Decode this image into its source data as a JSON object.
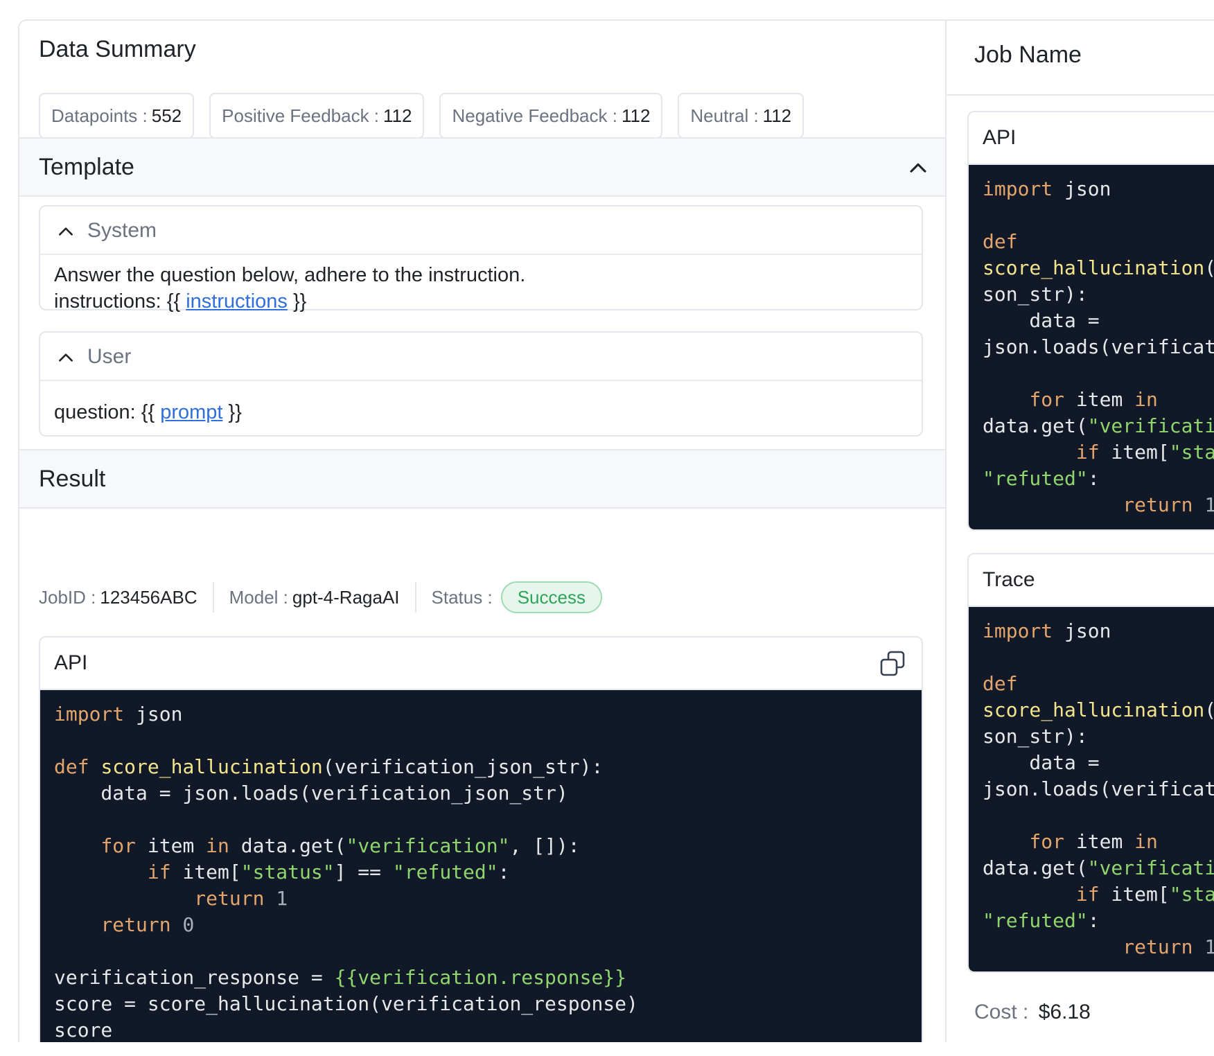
{
  "data_summary": {
    "title": "Data Summary",
    "stats": [
      {
        "label": "Datapoints :",
        "value": "552"
      },
      {
        "label": "Positive Feedback :",
        "value": "112"
      },
      {
        "label": "Negative Feedback :",
        "value": "112"
      },
      {
        "label": "Neutral :",
        "value": "112"
      }
    ]
  },
  "template": {
    "title": "Template",
    "system": {
      "label": "System",
      "line1": "Answer the question below, adhere to the instruction.",
      "line2_prefix": "instructions: {{ ",
      "line2_var": "instructions",
      "line2_suffix": " }}"
    },
    "user": {
      "label": "User",
      "prefix": "question: {{ ",
      "var": "prompt",
      "suffix": " }}"
    }
  },
  "result": {
    "title": "Result",
    "job_id_label": "JobID :",
    "job_id": "123456ABC",
    "model_label": "Model :",
    "model": "gpt-4-RagaAI",
    "status_label": "Status :",
    "status": "Success",
    "api_label": "API"
  },
  "right": {
    "job_name": "Job Name",
    "api_label": "API",
    "trace_label": "Trace",
    "cost_label": "Cost :",
    "cost": "$6.18"
  },
  "colors": {
    "code_bg": "#111827",
    "keyword": "#e3a56b",
    "function": "#f3e58c",
    "string": "#8fd66d",
    "link": "#2f6fdb",
    "success": "#2ea45a"
  },
  "icons": [
    "chevron-up-icon",
    "copy-icon"
  ]
}
